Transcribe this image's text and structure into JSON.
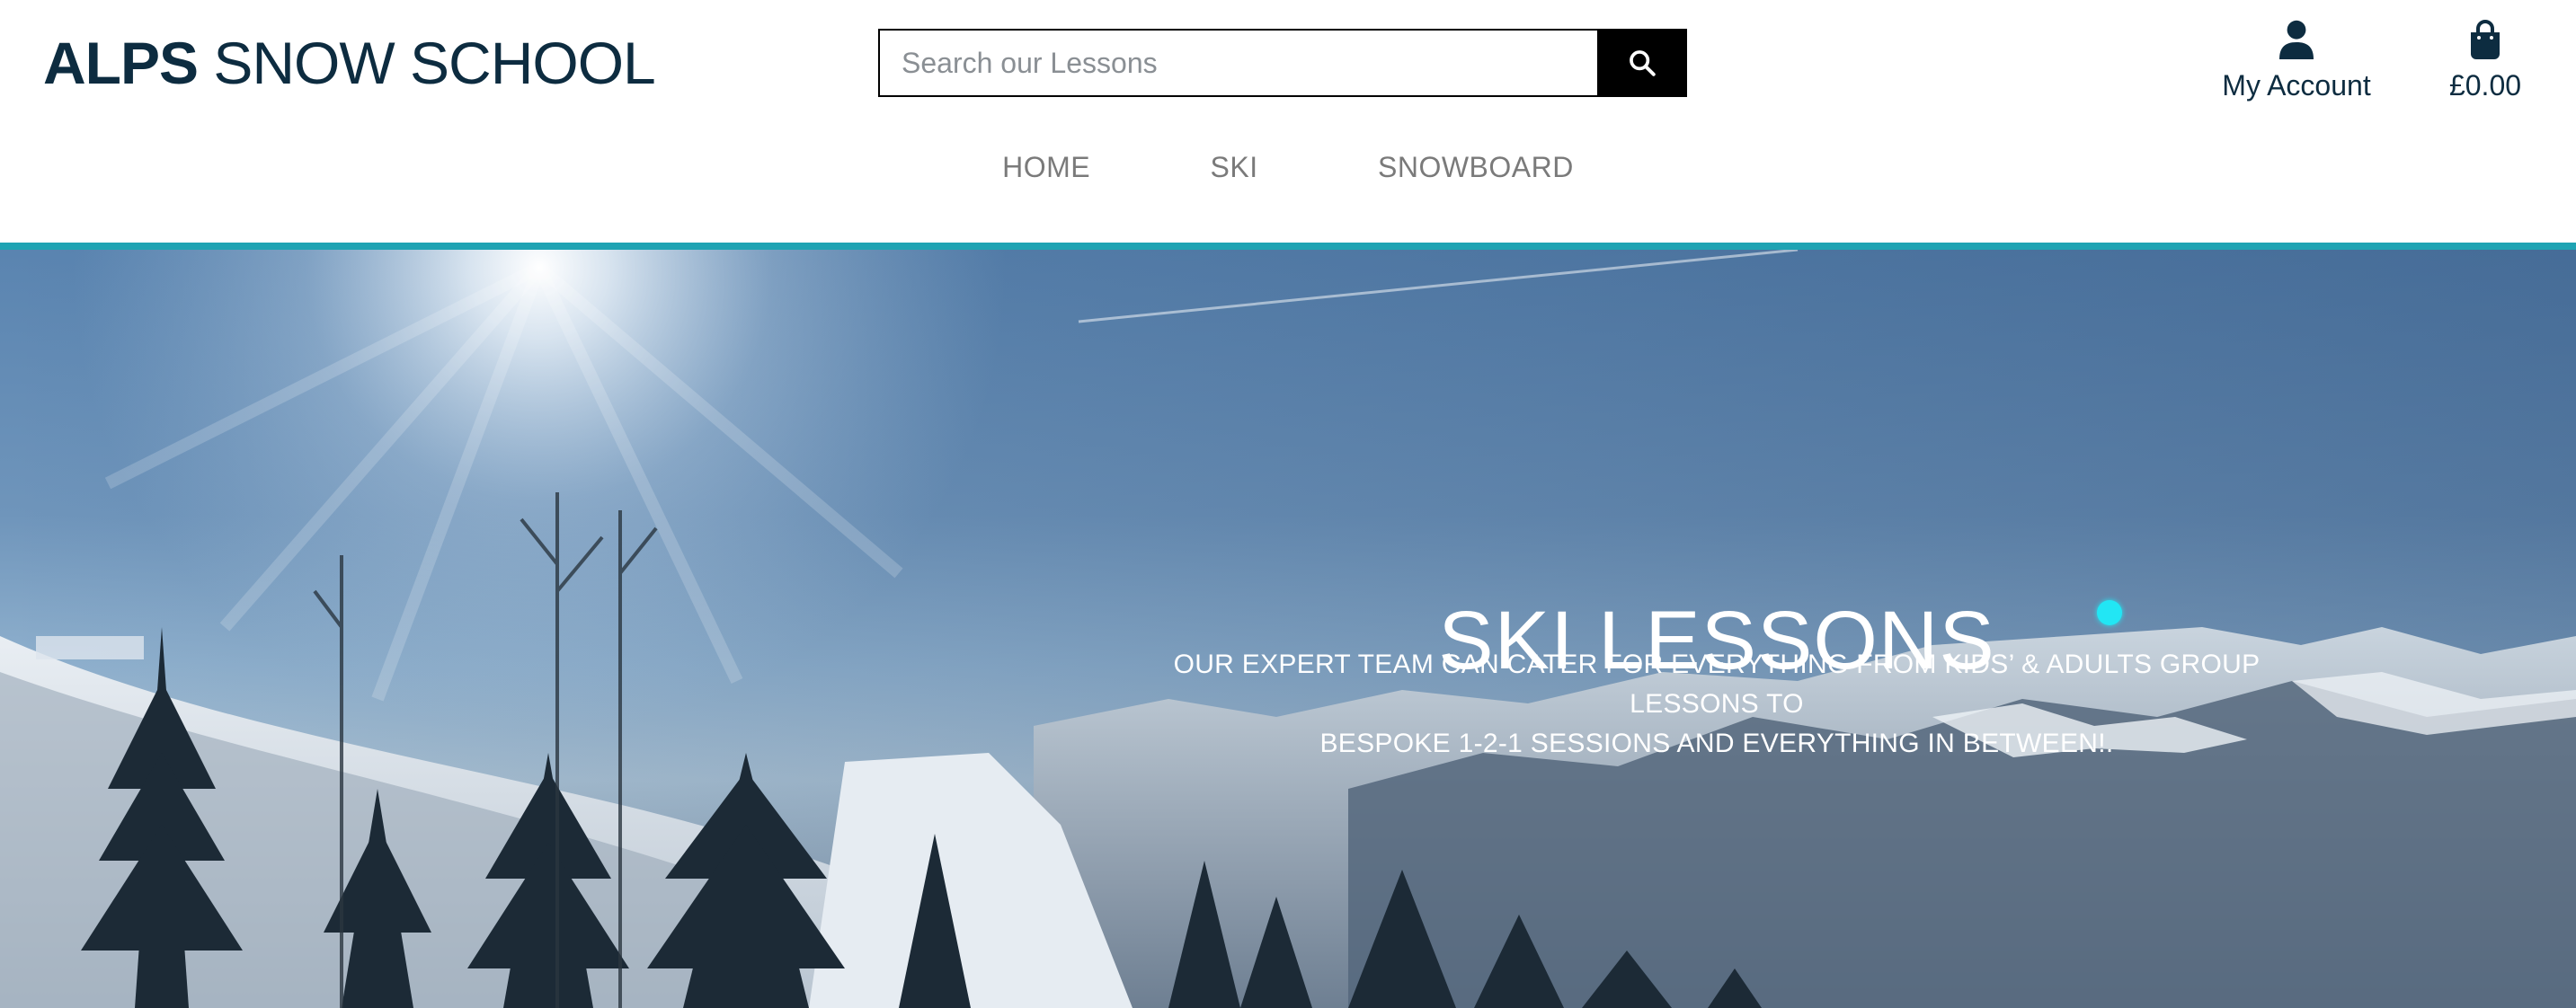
{
  "brand": {
    "bold": "ALPS",
    "rest": " SNOW SCHOOL"
  },
  "search": {
    "placeholder": "Search our Lessons"
  },
  "account": {
    "label": "My Account",
    "icon": "user-icon"
  },
  "bag": {
    "total": "£0.00",
    "icon": "shopping-bag-icon"
  },
  "nav": {
    "items": [
      "HOME",
      "SKI",
      "SNOWBOARD"
    ]
  },
  "hero": {
    "title": "SKI LESSONS",
    "subtitle_line1": "OUR EXPERT TEAM CAN CATER FOR EVERYTHING FROM KIDS’ & ADULTS GROUP LESSONS TO",
    "subtitle_line2": "BESPOKE 1-2-1 SESSIONS AND EVERYTHING IN BETWEEN!."
  },
  "colors": {
    "brand": "#0d2c40",
    "accent": "#1fa3b3",
    "nav": "#7a7a7a",
    "cursor_dot": "#22e6f4"
  }
}
